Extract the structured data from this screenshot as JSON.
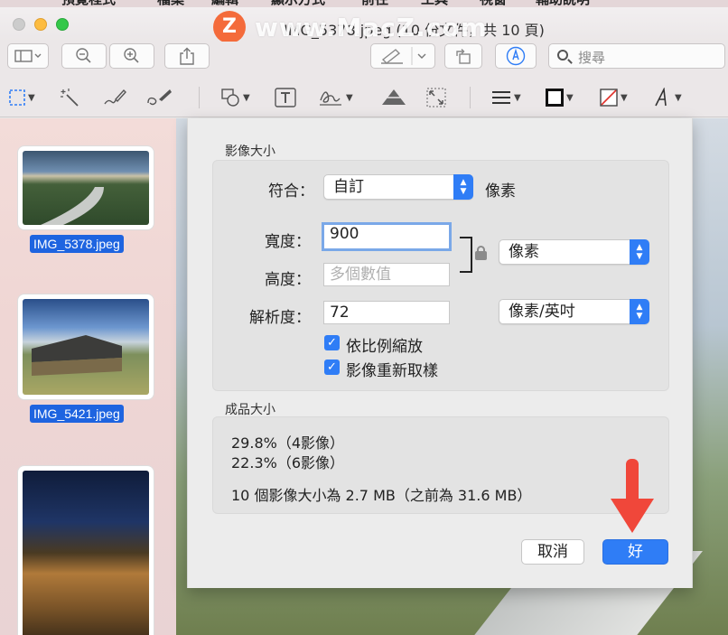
{
  "menubar": {
    "items": [
      "預覽程式",
      "檔案",
      "編輯",
      "顯示方式",
      "前往",
      "工具",
      "視窗",
      "輔助說明"
    ]
  },
  "window": {
    "title": "IMG_5378.jpeg (10 份文件，共 10 頁)",
    "watermark": "www.MacZ.com",
    "logo_letter": "Z"
  },
  "toolbar": {
    "search_placeholder": "搜尋"
  },
  "sidebar": {
    "items": [
      {
        "label": "IMG_5378.jpeg"
      },
      {
        "label": "IMG_5421.jpeg"
      },
      {
        "label": ""
      }
    ]
  },
  "dialog": {
    "image_size_title": "影像大小",
    "fit_label": "符合：",
    "fit_value": "自訂",
    "fit_unit": "像素",
    "width_label": "寬度：",
    "width_value": "900",
    "height_label": "高度：",
    "height_placeholder": "多個數值",
    "size_unit": "像素",
    "resolution_label": "解析度：",
    "resolution_value": "72",
    "resolution_unit": "像素/英吋",
    "scale_proportionally": "依比例縮放",
    "resample": "影像重新取樣",
    "result_title": "成品大小",
    "result_line1": "29.8%（4影像）",
    "result_line2": "22.3%（6影像）",
    "result_summary": "10 個影像大小為 2.7 MB（之前為 31.6 MB）",
    "cancel_label": "取消",
    "ok_label": "好"
  },
  "colors": {
    "accent": "#2f7df6",
    "arrow": "#f0473a"
  }
}
